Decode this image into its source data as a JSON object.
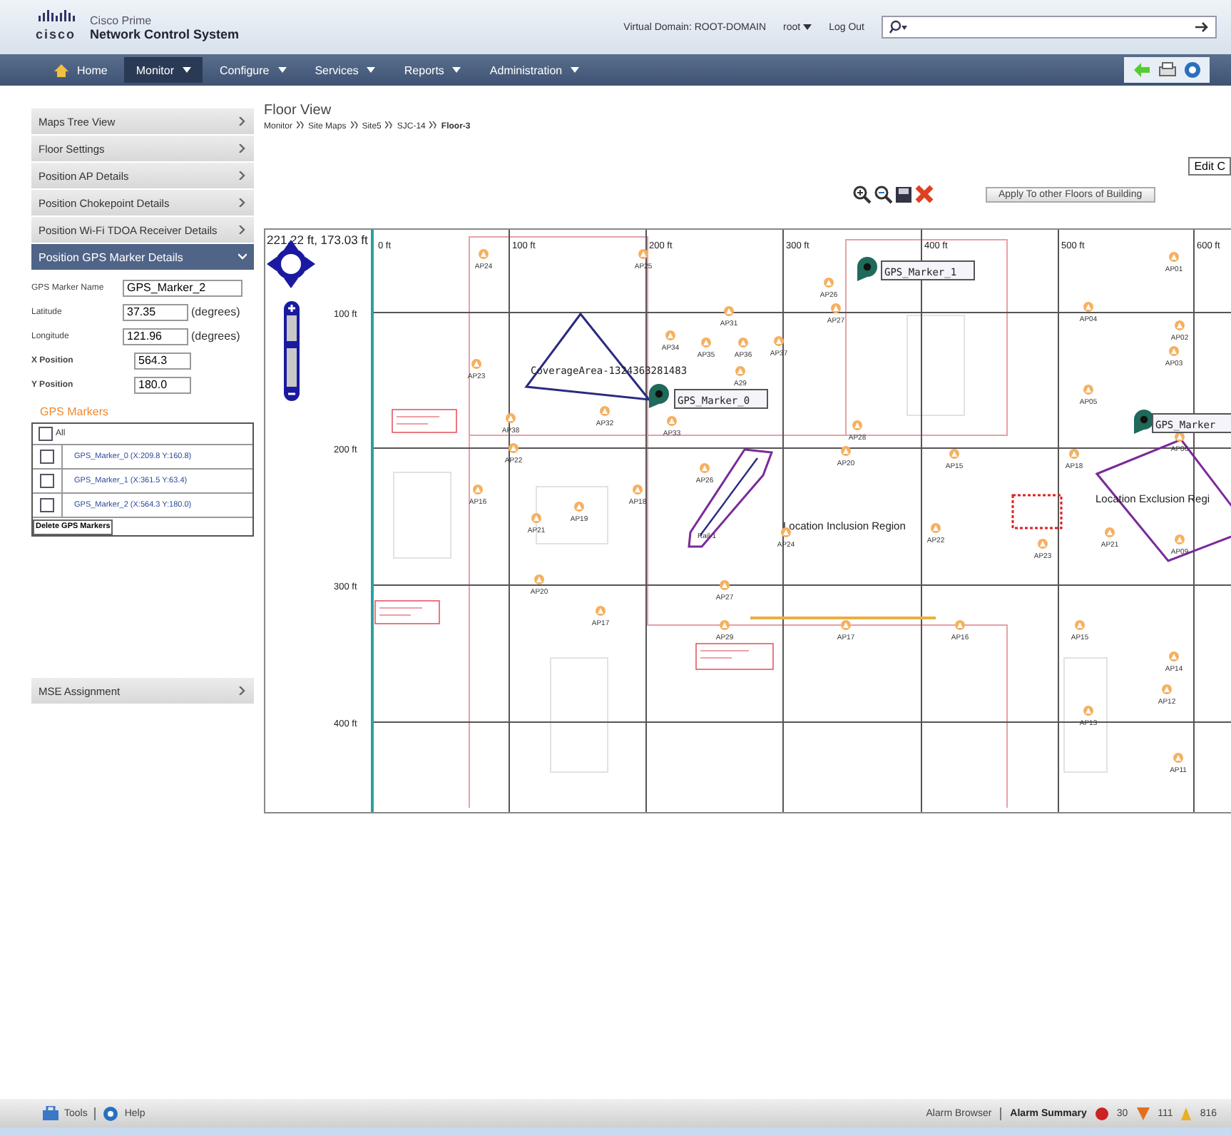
{
  "header": {
    "logo": "cisco",
    "product_line": "Cisco Prime",
    "product": "Network Control System",
    "virtual_domain": "Virtual Domain: ROOT-DOMAIN",
    "user": "root",
    "logout": "Log Out"
  },
  "nav": [
    {
      "label": "Home",
      "kind": "home",
      "selected": false
    },
    {
      "label": "Monitor",
      "kind": "menu",
      "selected": true
    },
    {
      "label": "Configure",
      "kind": "menu",
      "selected": false
    },
    {
      "label": "Services",
      "kind": "menu",
      "selected": false
    },
    {
      "label": "Reports",
      "kind": "menu",
      "selected": false
    },
    {
      "label": "Administration",
      "kind": "menu",
      "selected": false
    }
  ],
  "sidebar": {
    "items": [
      {
        "label": "Maps Tree View",
        "expanded": false
      },
      {
        "label": "Floor Settings",
        "expanded": false
      },
      {
        "label": "Position AP Details",
        "expanded": false
      },
      {
        "label": "Position Chokepoint Details",
        "expanded": false
      },
      {
        "label": "Position Wi-Fi TDOA Receiver Details",
        "expanded": false
      },
      {
        "label": "Position GPS Marker Details",
        "expanded": true
      }
    ],
    "fields": [
      {
        "label": "GPS Marker Name",
        "value": "GPS_Marker_2",
        "bold": false
      },
      {
        "label": "Latitude",
        "value": "37.35",
        "unit": "(degrees)",
        "bold": false
      },
      {
        "label": "Longitude",
        "value": "121.96",
        "unit": "(degrees)",
        "bold": false
      },
      {
        "label": "X Position",
        "value": "564.3",
        "bold": true
      },
      {
        "label": "Y Position",
        "value": "180.0",
        "bold": true
      }
    ],
    "gps_markers": {
      "title": "GPS Markers",
      "all": {
        "label": "All",
        "checked": false
      },
      "rows": [
        {
          "label": "GPS_Marker_0 (X:209.8 Y:160.8)",
          "checked": false
        },
        {
          "label": "GPS_Marker_1 (X:361.5 Y:63.4)",
          "checked": false
        },
        {
          "label": "GPS_Marker_2 (X:564.3 Y:180.0)",
          "checked": false
        }
      ],
      "delete_button": "Delete GPS Markers"
    },
    "bottom_item": {
      "label": "MSE Assignment",
      "expanded": false
    }
  },
  "floor_view": {
    "title": "Floor View",
    "breadcrumb": [
      "Monitor",
      "Site Maps",
      "Site5",
      "SJC-14",
      "Floor-3"
    ],
    "edit_button": "Edit C",
    "apply_button": "Apply To other Floors of Building",
    "map": {
      "cursor": "221.22 ft, 173.03 ft",
      "x_scale": [
        "0 ft",
        "100 ft",
        "200 ft",
        "300 ft",
        "400 ft",
        "500 ft",
        "600 ft"
      ],
      "y_scale": [
        "100 ft",
        "200 ft",
        "300 ft",
        "400 ft"
      ],
      "access_points": [
        "AP24",
        "AP25",
        "AP26",
        "AP27",
        "AP31",
        "AP34",
        "AP35",
        "AP36",
        "AP37",
        "A29",
        "AP23",
        "AP32",
        "AP33",
        "AP38",
        "AP28",
        "AP20",
        "AP15",
        "AP18",
        "AP22",
        "AP26",
        "AP16",
        "AP19",
        "AP18",
        "AP21",
        "AP20",
        "AP17",
        "AP27",
        "AP29",
        "AP24",
        "AP22",
        "AP23",
        "AP21",
        "AP09",
        "AP17",
        "AP16",
        "AP15",
        "AP14",
        "AP12",
        "AP13",
        "AP11",
        "AP01",
        "AP04",
        "AP02",
        "AP03",
        "AP05",
        "AP06"
      ],
      "gps_markers": [
        "GPS_Marker_0",
        "GPS_Marker_1",
        "GPS_Marker"
      ],
      "coverage_area": "CoverageArea-1324363281483",
      "rail": "Rail-1",
      "inclusion_region": "Location Inclusion Region",
      "exclusion_region": "Location Exclusion Regi"
    }
  },
  "status_bar": {
    "left": [
      {
        "kind": "tools",
        "label": "Tools"
      },
      {
        "kind": "help",
        "label": "Help"
      }
    ],
    "alarm_browser": "Alarm Browser",
    "alarm_summary": "Alarm Summary",
    "alarms": [
      {
        "kind": "critical",
        "count": "30",
        "color": "#cc2222"
      },
      {
        "kind": "major",
        "count": "111",
        "color": "#e07020"
      },
      {
        "kind": "minor",
        "count": "816",
        "color": "#e8b020"
      }
    ]
  }
}
